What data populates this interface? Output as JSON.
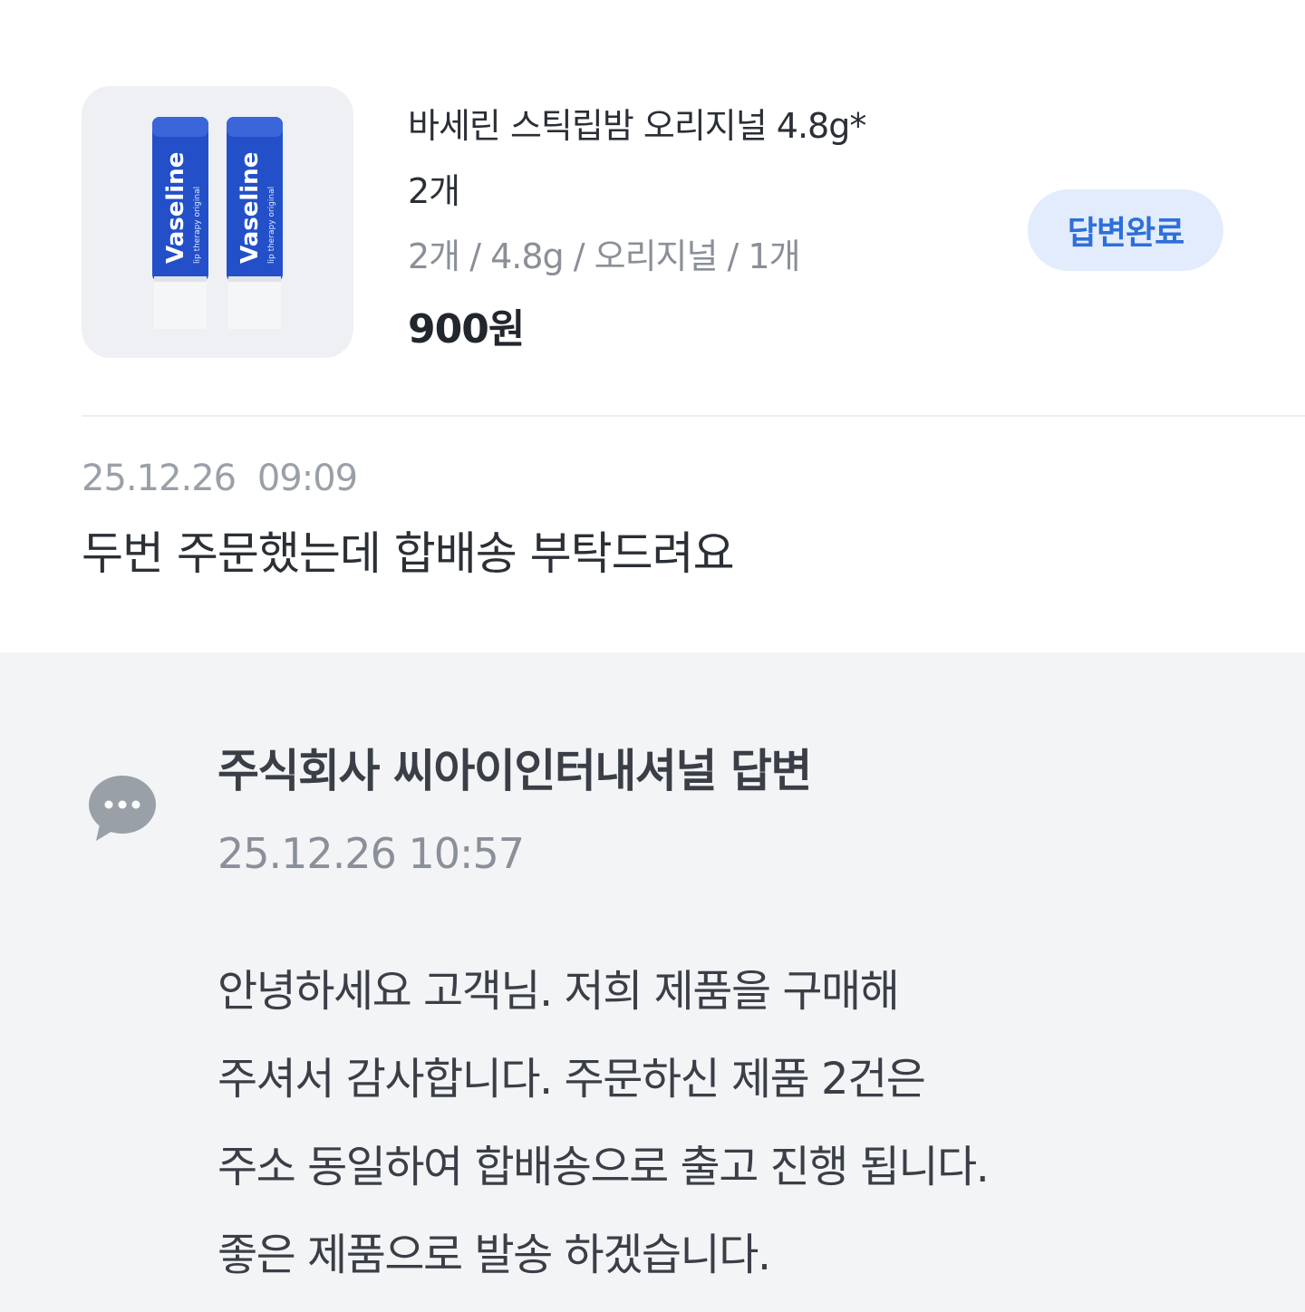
{
  "product": {
    "image_alt": "Vaseline lip therapy original",
    "image_brand_text": "Vaseline",
    "name_line1": "바세린 스틱립밤 오리지널 4.8g*",
    "name_line2": "2개",
    "option": "2개 / 4.8g / 오리지널 / 1개",
    "price": "900원",
    "status": "답변완료"
  },
  "question": {
    "date": "25.12.26 09:09",
    "text": "두번 주문했는데 합배송 부탁드려요"
  },
  "answer": {
    "icon": "chat-bubble-icon",
    "title": "주식회사 씨아이인터내셔널 답변",
    "date": "25.12.26 10:57",
    "lines": [
      "안녕하세요 고객님. 저희 제품을 구매해",
      "주셔서 감사합니다. 주문하신 제품 2건은",
      "주소 동일하여 합배송으로 출고 진행 됩니다.",
      "좋은 제품으로 발송 하겠습니다."
    ]
  },
  "colors": {
    "badge_bg": "#e2ecfc",
    "badge_text": "#2e6fd9",
    "answer_bg": "#f3f4f6",
    "vaseline_blue": "#1f4fc4"
  }
}
